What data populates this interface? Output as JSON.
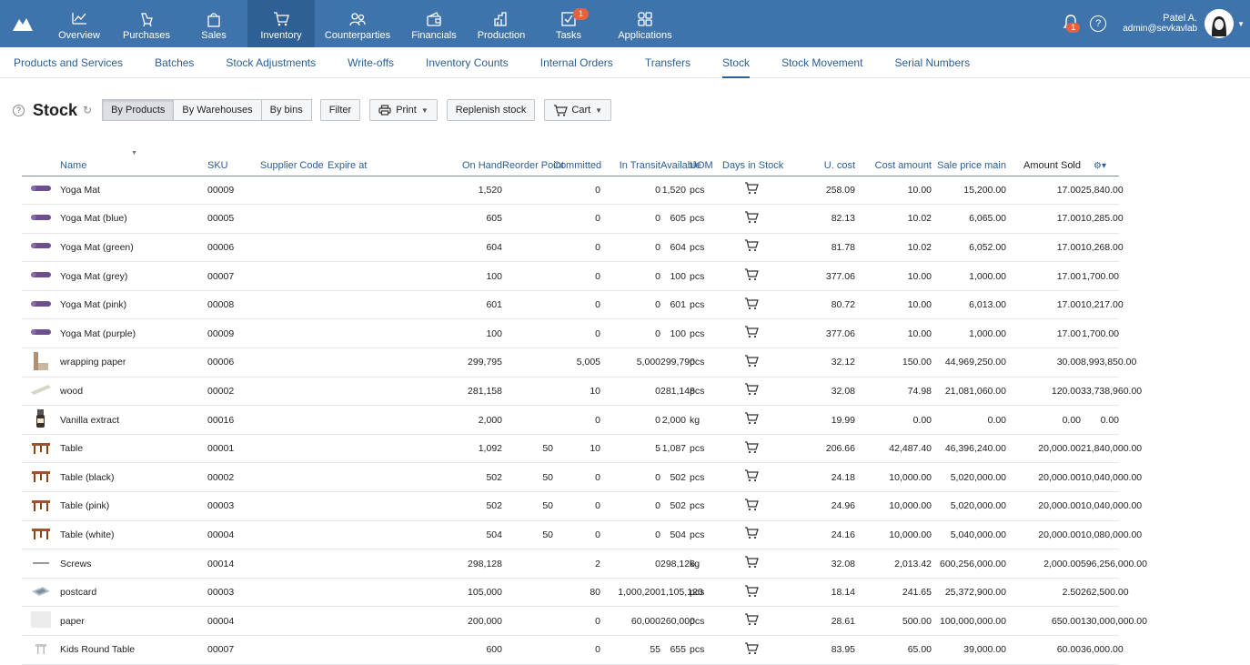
{
  "nav": {
    "items": [
      {
        "label": "Overview",
        "icon": "chart-line-icon"
      },
      {
        "label": "Purchases",
        "icon": "bag-icon"
      },
      {
        "label": "Sales",
        "icon": "shopping-bag-icon"
      },
      {
        "label": "Inventory",
        "icon": "cart-icon"
      },
      {
        "label": "Counterparties",
        "icon": "people-icon"
      },
      {
        "label": "Financials",
        "icon": "wallet-icon"
      },
      {
        "label": "Production",
        "icon": "factory-icon"
      },
      {
        "label": "Tasks",
        "icon": "tasks-icon",
        "badge": "1"
      },
      {
        "label": "Applications",
        "icon": "grid-icon"
      }
    ],
    "bell_badge": "1",
    "help": "?",
    "user_name": "Patel A.",
    "user_email": "admin@sevkavlab"
  },
  "subnav": [
    "Products and Services",
    "Batches",
    "Stock Adjustments",
    "Write-offs",
    "Inventory Counts",
    "Internal Orders",
    "Transfers",
    "Stock",
    "Stock Movement",
    "Serial Numbers"
  ],
  "toolbar": {
    "help": "?",
    "title": "Stock",
    "refresh": "↻",
    "by_products": "By Products",
    "by_warehouses": "By Warehouses",
    "by_bins": "By bins",
    "filter": "Filter",
    "print": "Print",
    "replenish": "Replenish stock",
    "cart": "Cart"
  },
  "columns": {
    "name": "Name",
    "sku": "SKU",
    "supplier_code": "Supplier Code",
    "expire_at": "Expire at",
    "on_hand": "On Hand",
    "reorder_point": "Reorder Point",
    "committed": "Committed",
    "in_transit": "In Transit",
    "available": "Available",
    "uom": "UOM",
    "days_in_stock": "Days in Stock",
    "u_cost": "U. cost",
    "cost_amount": "Cost amount",
    "sale_price_main": "Sale price main",
    "amount_sold": "Amount Sold"
  },
  "colors": {
    "topbar": "#3f73ac",
    "active": "#2e5f95",
    "link": "#2c5d93",
    "badge": "#e8603c"
  },
  "rows": [
    {
      "thumb": "yoga",
      "name": "Yoga Mat",
      "sku": "00009",
      "on_hand": "1,520",
      "reorder": "",
      "committed": "0",
      "transit": "0",
      "available": "1,520",
      "uom": "pcs",
      "days": "258.09",
      "ucost": "10.00",
      "cost": "15,200.00",
      "sale": "17.00",
      "sold": "25,840.00"
    },
    {
      "thumb": "yoga",
      "name": "Yoga Mat (blue)",
      "sku": "00005",
      "on_hand": "605",
      "reorder": "",
      "committed": "0",
      "transit": "0",
      "available": "605",
      "uom": "pcs",
      "days": "82.13",
      "ucost": "10.02",
      "cost": "6,065.00",
      "sale": "17.00",
      "sold": "10,285.00"
    },
    {
      "thumb": "yoga",
      "name": "Yoga Mat (green)",
      "sku": "00006",
      "on_hand": "604",
      "reorder": "",
      "committed": "0",
      "transit": "0",
      "available": "604",
      "uom": "pcs",
      "days": "81.78",
      "ucost": "10.02",
      "cost": "6,052.00",
      "sale": "17.00",
      "sold": "10,268.00"
    },
    {
      "thumb": "yoga",
      "name": "Yoga Mat (grey)",
      "sku": "00007",
      "on_hand": "100",
      "reorder": "",
      "committed": "0",
      "transit": "0",
      "available": "100",
      "uom": "pcs",
      "days": "377.06",
      "ucost": "10.00",
      "cost": "1,000.00",
      "sale": "17.00",
      "sold": "1,700.00"
    },
    {
      "thumb": "yoga",
      "name": "Yoga Mat (pink)",
      "sku": "00008",
      "on_hand": "601",
      "reorder": "",
      "committed": "0",
      "transit": "0",
      "available": "601",
      "uom": "pcs",
      "days": "80.72",
      "ucost": "10.00",
      "cost": "6,013.00",
      "sale": "17.00",
      "sold": "10,217.00"
    },
    {
      "thumb": "yoga",
      "name": "Yoga Mat (purple)",
      "sku": "00009",
      "on_hand": "100",
      "reorder": "",
      "committed": "0",
      "transit": "0",
      "available": "100",
      "uom": "pcs",
      "days": "377.06",
      "ucost": "10.00",
      "cost": "1,000.00",
      "sale": "17.00",
      "sold": "1,700.00"
    },
    {
      "thumb": "paper",
      "name": "wrapping paper",
      "sku": "00006",
      "on_hand": "299,795",
      "reorder": "",
      "committed": "5,005",
      "transit": "5,000",
      "available": "299,790",
      "uom": "pcs",
      "days": "32.12",
      "ucost": "150.00",
      "cost": "44,969,250.00",
      "sale": "30.00",
      "sold": "8,993,850.00"
    },
    {
      "thumb": "wood",
      "name": "wood",
      "sku": "00002",
      "on_hand": "281,158",
      "reorder": "",
      "committed": "10",
      "transit": "0",
      "available": "281,148",
      "uom": "pcs",
      "days": "32.08",
      "ucost": "74.98",
      "cost": "21,081,060.00",
      "sale": "120.00",
      "sold": "33,738,960.00"
    },
    {
      "thumb": "vanilla",
      "name": "Vanilla extract",
      "sku": "00016",
      "on_hand": "2,000",
      "reorder": "",
      "committed": "0",
      "transit": "0",
      "available": "2,000",
      "uom": "kg",
      "days": "19.99",
      "ucost": "0.00",
      "cost": "0.00",
      "sale": "0.00",
      "sold": "0.00"
    },
    {
      "thumb": "table",
      "name": "Table",
      "sku": "00001",
      "on_hand": "1,092",
      "reorder": "50",
      "committed": "10",
      "transit": "5",
      "available": "1,087",
      "uom": "pcs",
      "days": "206.66",
      "ucost": "42,487.40",
      "cost": "46,396,240.00",
      "sale": "20,000.00",
      "sold": "21,840,000.00"
    },
    {
      "thumb": "table",
      "name": "Table (black)",
      "sku": "00002",
      "on_hand": "502",
      "reorder": "50",
      "committed": "0",
      "transit": "0",
      "available": "502",
      "uom": "pcs",
      "days": "24.18",
      "ucost": "10,000.00",
      "cost": "5,020,000.00",
      "sale": "20,000.00",
      "sold": "10,040,000.00"
    },
    {
      "thumb": "table",
      "name": "Table (pink)",
      "sku": "00003",
      "on_hand": "502",
      "reorder": "50",
      "committed": "0",
      "transit": "0",
      "available": "502",
      "uom": "pcs",
      "days": "24.96",
      "ucost": "10,000.00",
      "cost": "5,020,000.00",
      "sale": "20,000.00",
      "sold": "10,040,000.00"
    },
    {
      "thumb": "table",
      "name": "Table (white)",
      "sku": "00004",
      "on_hand": "504",
      "reorder": "50",
      "committed": "0",
      "transit": "0",
      "available": "504",
      "uom": "pcs",
      "days": "24.16",
      "ucost": "10,000.00",
      "cost": "5,040,000.00",
      "sale": "20,000.00",
      "sold": "10,080,000.00"
    },
    {
      "thumb": "screw",
      "name": "Screws",
      "sku": "00014",
      "on_hand": "298,128",
      "reorder": "",
      "committed": "2",
      "transit": "0",
      "available": "298,126",
      "uom": "kg",
      "days": "32.08",
      "ucost": "2,013.42",
      "cost": "600,256,000.00",
      "sale": "2,000.00",
      "sold": "596,256,000.00"
    },
    {
      "thumb": "postcard",
      "name": "postcard",
      "sku": "00003",
      "on_hand": "105,000",
      "reorder": "",
      "committed": "80",
      "transit": "1,000,200",
      "available": "1,105,120",
      "uom": "pcs",
      "days": "18.14",
      "ucost": "241.65",
      "cost": "25,372,900.00",
      "sale": "2.50",
      "sold": "262,500.00"
    },
    {
      "thumb": "blank",
      "name": "paper",
      "sku": "00004",
      "on_hand": "200,000",
      "reorder": "",
      "committed": "0",
      "transit": "60,000",
      "available": "260,000",
      "uom": "pcs",
      "days": "28.61",
      "ucost": "500.00",
      "cost": "100,000,000.00",
      "sale": "650.00",
      "sold": "130,000,000.00"
    },
    {
      "thumb": "kids",
      "name": "Kids Round Table",
      "sku": "00007",
      "on_hand": "600",
      "reorder": "",
      "committed": "0",
      "transit": "55",
      "available": "655",
      "uom": "pcs",
      "days": "83.95",
      "ucost": "65.00",
      "cost": "39,000.00",
      "sale": "60.00",
      "sold": "36,000.00"
    }
  ]
}
